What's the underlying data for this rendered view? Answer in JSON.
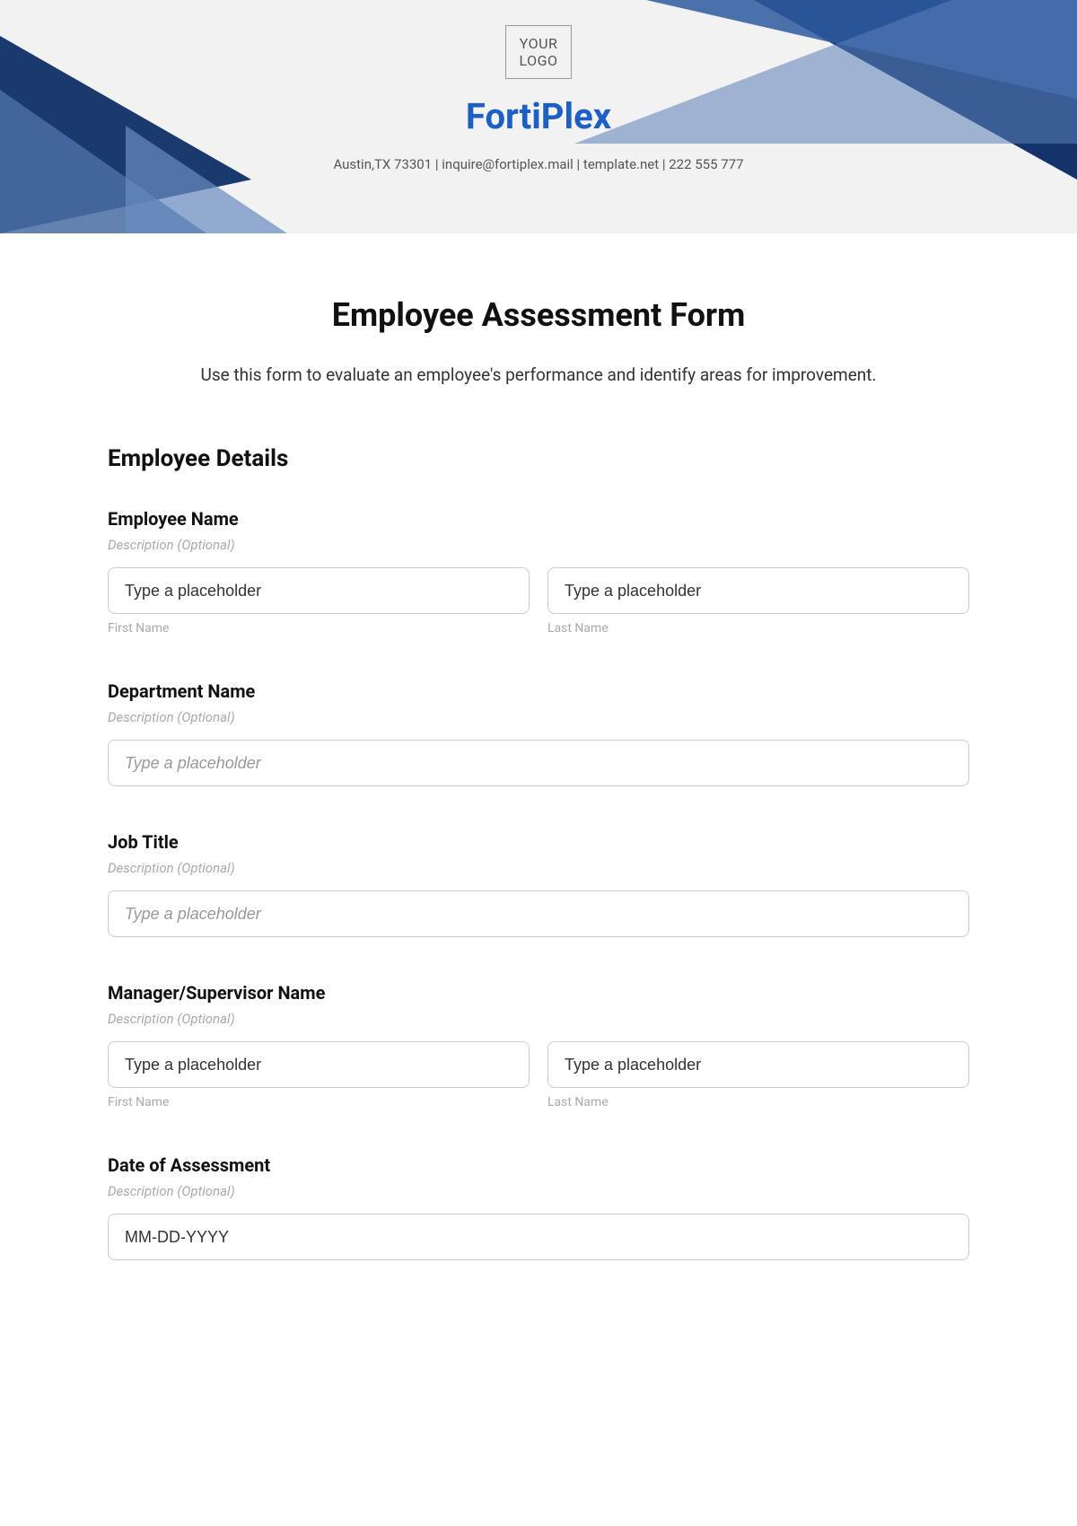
{
  "header": {
    "logo_text": "YOUR\nLOGO",
    "company": "FortiPlex",
    "contact": "Austin,TX 73301 | inquire@fortiplex.mail | template.net | 222 555 777"
  },
  "form": {
    "title": "Employee Assessment Form",
    "intro": "Use this form to evaluate an employee's performance and identify areas for improvement.",
    "section_heading": "Employee Details",
    "desc_optional": "Description (Optional)",
    "placeholder_text": "Type a placeholder",
    "first_name_label": "First Name",
    "last_name_label": "Last Name",
    "fields": {
      "employee_name": {
        "label": "Employee Name"
      },
      "department": {
        "label": "Department Name"
      },
      "job_title": {
        "label": "Job Title"
      },
      "manager": {
        "label": "Manager/Supervisor Name"
      },
      "date": {
        "label": "Date of Assessment",
        "placeholder": "MM-DD-YYYY"
      }
    }
  }
}
